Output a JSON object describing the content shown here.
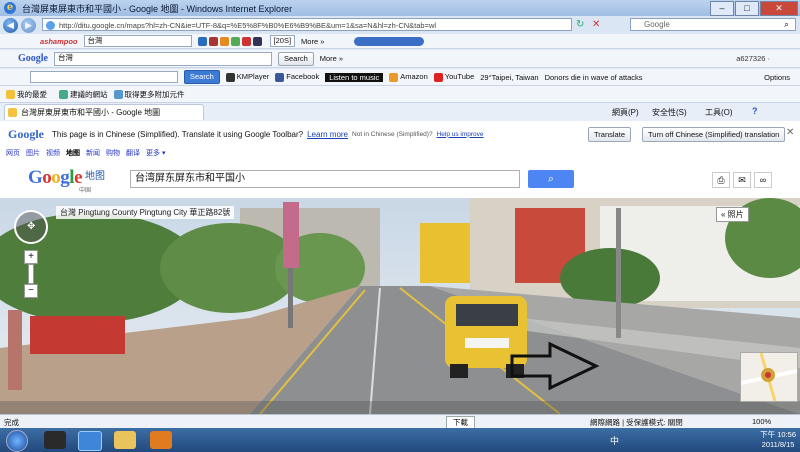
{
  "window": {
    "title": "台灣屏東屏東市和平國小 - Google 地圖 - Windows Internet Explorer",
    "minimize": "–",
    "maximize": "□",
    "close": "✕"
  },
  "address": {
    "url": "http://ditu.google.cn/maps?hl=zh-CN&ie=UTF-8&q=%E5%8F%B0%E6%B9%BE&um=1&sa=N&hl=zh-CN&tab=wl",
    "search_placeholder": "Google"
  },
  "ask_toolbar": {
    "brand": "ashampoo",
    "query": "台灣",
    "page_num": "[20S]",
    "more": "More »"
  },
  "google_toolbar": {
    "logo": "Google",
    "query": "台灣",
    "search": "Search",
    "more": "More »",
    "account": "a627326 ·"
  },
  "links_toolbar": {
    "search_btn": "Search",
    "kmplayer": "KMPlayer",
    "facebook": "Facebook",
    "music": "Listen to music",
    "amazon": "Amazon",
    "youtube": "YouTube",
    "taipei": "29°Taipei, Taiwan",
    "news": "Donors die in wave of attacks ...",
    "options": "Options"
  },
  "favorites_bar": {
    "favorites": "我的最愛",
    "suggested": "建議的網站",
    "addons": "取得更多附加元件"
  },
  "command_bar": {
    "page": "網頁(P)",
    "safety": "安全性(S)",
    "tools": "工具(O)",
    "help": "?"
  },
  "tab": {
    "title": "台灣屏東屏東市和平國小 - Google 地圖"
  },
  "translate": {
    "logo": "Google",
    "message": "This page is in Chinese (Simplified). Translate it using Google Toolbar?",
    "learn_more": "Learn more",
    "not_chinese": "Not in Chinese (Simplified)?",
    "help_improve": "Help us improve",
    "translate_btn": "Translate",
    "turn_off_btn": "Turn off Chinese (Simplified) translation"
  },
  "gbar": {
    "links": [
      "网页",
      "图片",
      "视频",
      "地图",
      "新闻",
      "购物",
      "翻译",
      "更多 ▾"
    ]
  },
  "gmaps": {
    "logo": "Google",
    "product": "地图",
    "region": "中国",
    "query": "台湾屏东屏东市和平国小"
  },
  "streetview": {
    "location": "台灣 Pingtung County Pingtung City 華正路82號",
    "photos_label": "« 照片"
  },
  "status": {
    "text": "完成",
    "download": "下載",
    "zone": "網際網路 | 受保護模式: 關閉",
    "zoom": "100%"
  },
  "taskbar": {
    "time": "下午 10:56",
    "date": "2011/8/15",
    "lang": "中"
  }
}
